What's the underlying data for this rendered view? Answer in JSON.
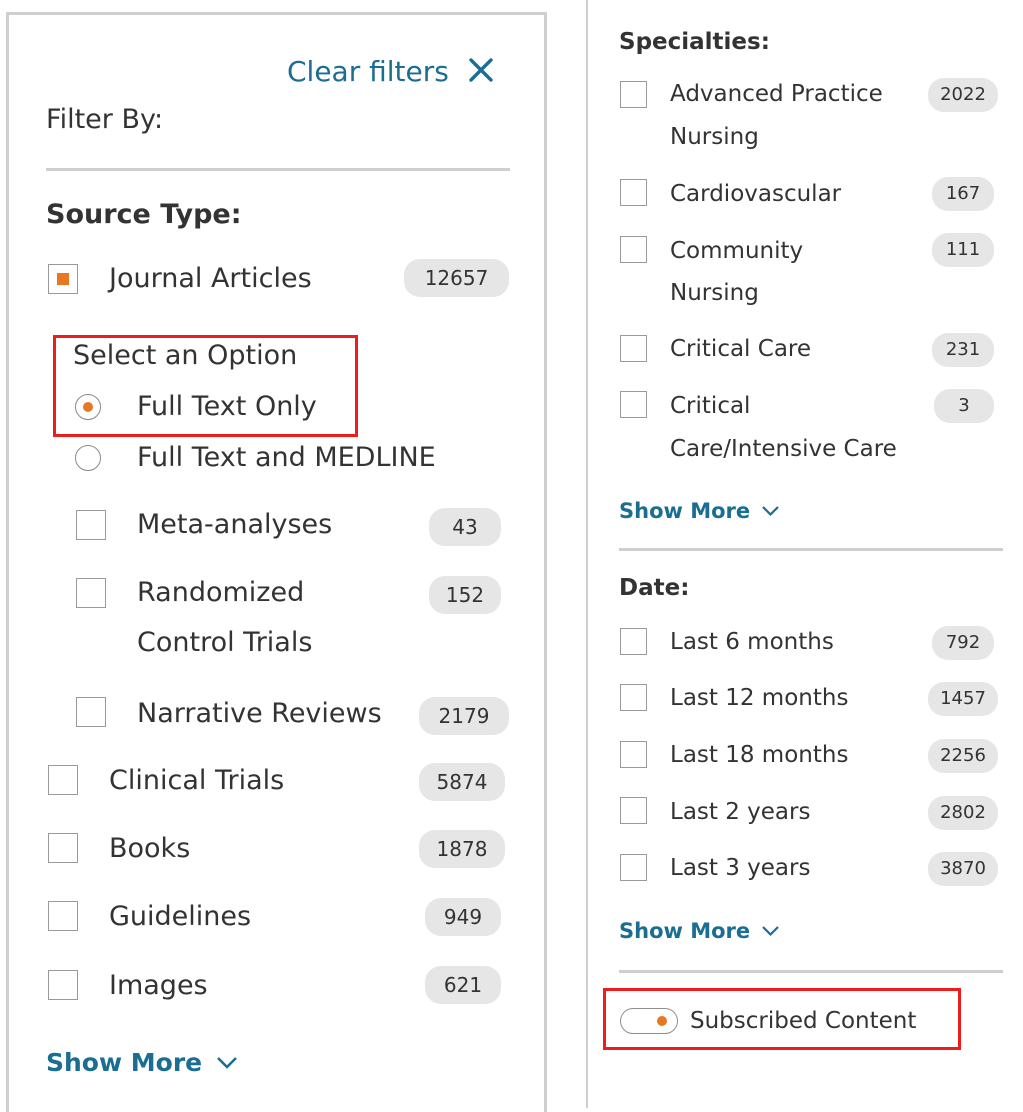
{
  "filters": {
    "clear_label": "Clear filters",
    "filter_by_label": "Filter By:",
    "source_type": {
      "heading": "Source Type:",
      "journal_articles": {
        "label": "Journal Articles",
        "count": "12657",
        "checked": true
      },
      "select_option_label": "Select an Option",
      "options": [
        {
          "label": "Full Text Only",
          "selected": true
        },
        {
          "label": "Full Text and MEDLINE",
          "selected": false
        }
      ],
      "sub_items": [
        {
          "label": "Meta-analyses",
          "count": "43"
        },
        {
          "label": "Randomized",
          "label2": "Control Trials",
          "count": "152"
        },
        {
          "label": "Narrative Reviews",
          "count": "2179"
        }
      ],
      "items": [
        {
          "label": "Clinical Trials",
          "count": "5874"
        },
        {
          "label": "Books",
          "count": "1878"
        },
        {
          "label": "Guidelines",
          "count": "949"
        },
        {
          "label": "Images",
          "count": "621"
        }
      ],
      "show_more": "Show More"
    },
    "specialties": {
      "heading": "Specialties:",
      "items": [
        {
          "label": "Advanced Practice",
          "label2": "Nursing",
          "count": "2022"
        },
        {
          "label": "Cardiovascular",
          "count": "167"
        },
        {
          "label": "Community",
          "label2": "Nursing",
          "count": "111"
        },
        {
          "label": "Critical Care",
          "count": "231"
        },
        {
          "label": "Critical",
          "label2": "Care/Intensive Care",
          "count": "3"
        }
      ],
      "show_more": "Show More"
    },
    "date": {
      "heading": "Date:",
      "items": [
        {
          "label": "Last 6 months",
          "count": "792"
        },
        {
          "label": "Last 12 months",
          "count": "1457"
        },
        {
          "label": "Last 18 months",
          "count": "2256"
        },
        {
          "label": "Last 2 years",
          "count": "2802"
        },
        {
          "label": "Last 3 years",
          "count": "3870"
        }
      ],
      "show_more": "Show More"
    },
    "subscribed_content": {
      "label": "Subscribed Content",
      "on": false
    }
  },
  "colors": {
    "accent": "#e87722",
    "link": "#1a6e91",
    "highlight": "#ee1c1c",
    "badge": "#e6e6e6"
  }
}
